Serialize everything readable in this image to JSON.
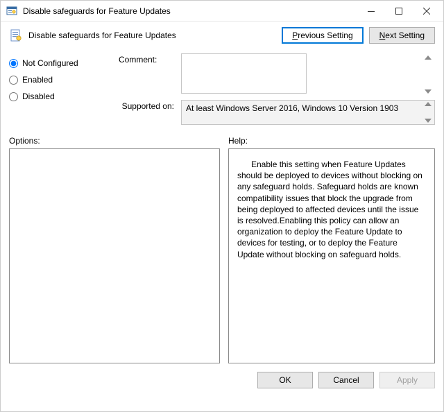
{
  "window": {
    "title": "Disable safeguards for Feature Updates"
  },
  "header": {
    "subtitle": "Disable safeguards for Feature Updates",
    "previous_label": "Previous Setting",
    "previous_hotkey": "P",
    "next_label": "Next Setting",
    "next_hotkey": "N"
  },
  "state_radio": {
    "not_configured": "Not Configured",
    "enabled": "Enabled",
    "disabled": "Disabled",
    "selected": "not_configured"
  },
  "fields": {
    "comment_label": "Comment:",
    "comment_value": "",
    "supported_label": "Supported on:",
    "supported_value": "At least Windows Server 2016, Windows 10 Version 1903"
  },
  "panels": {
    "options_label": "Options:",
    "help_label": "Help:",
    "help_text": "Enable this setting when Feature Updates should be deployed to devices without blocking on any safeguard holds. Safeguard holds are known compatibility issues that block the upgrade from being deployed to affected devices until the issue is resolved.Enabling this policy can allow an organization to deploy the Feature Update to devices for testing, or to deploy the Feature Update without blocking on safeguard holds."
  },
  "buttons": {
    "ok": "OK",
    "cancel": "Cancel",
    "apply": "Apply"
  }
}
